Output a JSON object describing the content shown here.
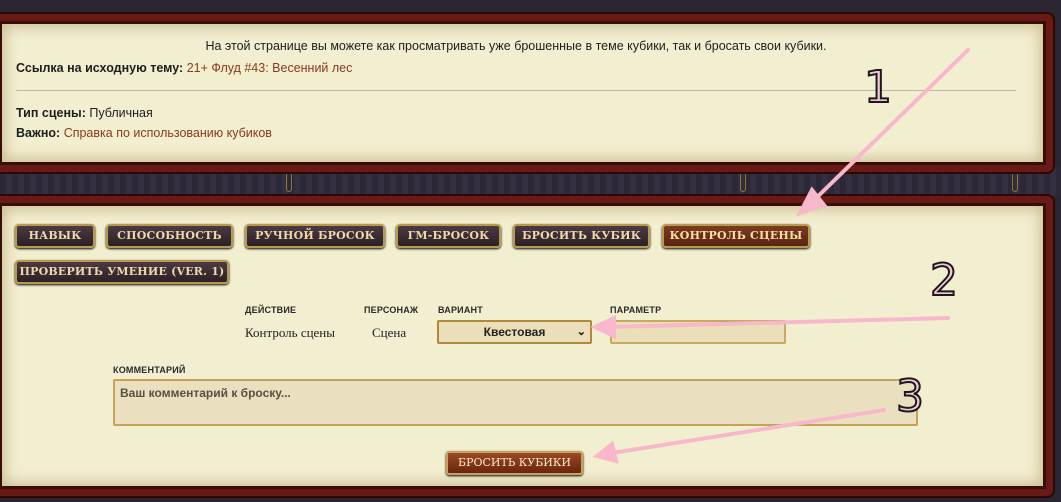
{
  "info": {
    "intro": "На этой странице вы можете как просматривать уже брошенные в теме кубики, так и бросать свои кубики.",
    "source_label": "Ссылка на исходную тему",
    "source_link": "21+ Флуд #43: Весенний лес",
    "scene_type_label": "Тип сцены",
    "scene_type_value": "Публичная",
    "important_label": "Важно",
    "important_link": "Справка по использованию кубиков"
  },
  "tabs": [
    {
      "label": "НАВЫК"
    },
    {
      "label": "СПОСОБНОСТЬ"
    },
    {
      "label": "РУЧНОЙ БРОСОК"
    },
    {
      "label": "ГМ-БРОСОК"
    },
    {
      "label": "БРОСИТЬ КУБИК"
    },
    {
      "label": "КОНТРОЛЬ СЦЕНЫ",
      "active": true
    },
    {
      "label": "ПРОВЕРИТЬ УМЕНИЕ (VER. 1)"
    }
  ],
  "form": {
    "action_label": "ДЕЙСТВИЕ",
    "action_value": "Контроль сцены",
    "character_label": "ПЕРСОНАЖ",
    "character_value": "Сцена",
    "variant_label": "ВАРИАНТ",
    "variant_value": "Квестовая",
    "param_label": "ПАРАМЕТР",
    "param_value": "",
    "comment_label": "КОММЕНТАРИЙ",
    "comment_placeholder": "Ваш комментарий к броску...",
    "submit_label": "БРОСИТЬ КУБИКИ"
  },
  "annotations": [
    "1",
    "2",
    "3"
  ],
  "colors": {
    "panel_bg": "#f2eed0",
    "panel_border": "#6a1a14",
    "link": "#8a3a1a",
    "tab_bg": "#3a2c34",
    "tab_active_bg": "#6a2e1a",
    "arrow": "#f7b8cc"
  }
}
